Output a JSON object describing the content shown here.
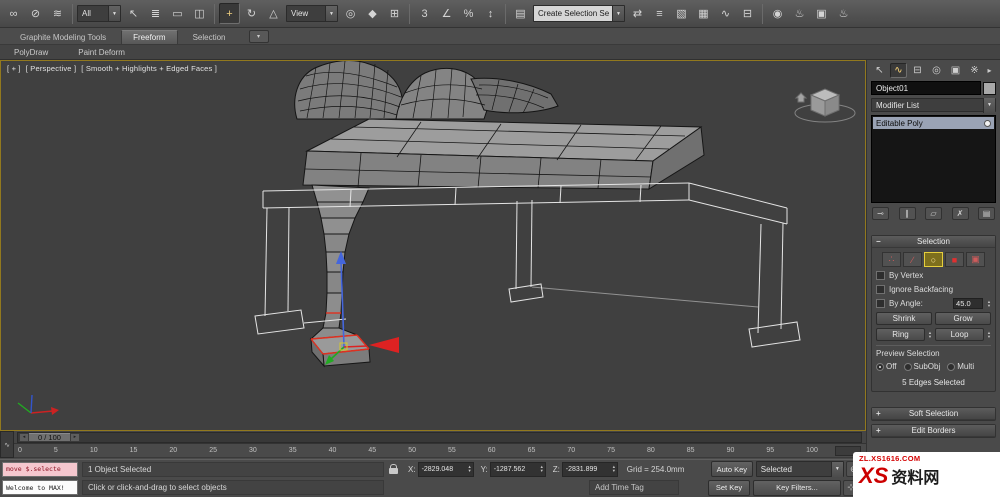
{
  "glyphs": {
    "combo_arrow": "▼",
    "spin_up": "▲",
    "spin_down": "▼",
    "slider_left": "◂",
    "slider_right": "▸",
    "rollout_open": "−",
    "rollout_closed": "+",
    "ribbon_toggle": "▾",
    "wave": "∿",
    "panel_menu": "▸",
    "zoom": "⊕",
    "zoom_all": "⊚",
    "pan": "⊹",
    "maximize": "⊞"
  },
  "toolbar": {
    "combos": {
      "filter": "All",
      "reference": "View",
      "selection_set": "Create Selection Se"
    },
    "icons_link": [
      {
        "n": "select-and-link-icon",
        "g": "∞"
      },
      {
        "n": "unlink-selection-icon",
        "g": "⊘"
      },
      {
        "n": "bind-to-spacewarp-icon",
        "g": "≋"
      }
    ],
    "icons_select": [
      {
        "n": "select-object-icon",
        "g": "↖"
      },
      {
        "n": "select-by-name-icon",
        "g": "≣"
      },
      {
        "n": "rectangular-selection-region-icon",
        "g": "▭"
      },
      {
        "n": "window-crossing-toggle-icon",
        "g": "◫"
      }
    ],
    "icons_transform": [
      {
        "n": "select-and-move-icon",
        "g": "+"
      },
      {
        "n": "select-and-rotate-icon",
        "g": "↻"
      },
      {
        "n": "select-and-scale-icon",
        "g": "△"
      }
    ],
    "icons_center": [
      {
        "n": "use-center-icon",
        "g": "◎"
      },
      {
        "n": "select-and-manipulate-icon",
        "g": "◆"
      },
      {
        "n": "keyboard-override-icon",
        "g": "⊞"
      }
    ],
    "icons_snap": [
      {
        "n": "snaps-toggle-icon",
        "g": "3"
      },
      {
        "n": "angle-snap-icon",
        "g": "∠"
      },
      {
        "n": "percent-snap-icon",
        "g": "%"
      },
      {
        "n": "spinner-snap-icon",
        "g": "↕"
      }
    ],
    "icons_named": [
      {
        "n": "edit-named-selection-sets-icon",
        "g": "▤"
      }
    ],
    "icons_tools": [
      {
        "n": "mirror-icon",
        "g": "⇄"
      },
      {
        "n": "align-icon",
        "g": "≡"
      },
      {
        "n": "layer-manager-icon",
        "g": "▧"
      },
      {
        "n": "graphite-ribbon-toggle-icon",
        "g": "▦"
      },
      {
        "n": "curve-editor-icon",
        "g": "∿"
      },
      {
        "n": "schematic-view-icon",
        "g": "⊟"
      }
    ],
    "icons_render": [
      {
        "n": "material-editor-icon",
        "g": "◉"
      },
      {
        "n": "render-setup-icon",
        "g": "♨"
      },
      {
        "n": "rendered-frame-window-icon",
        "g": "▣"
      },
      {
        "n": "render-production-icon",
        "g": "♨"
      }
    ]
  },
  "ribbon": {
    "tabs": [
      {
        "label": "Graphite Modeling Tools"
      },
      {
        "label": "Freeform"
      },
      {
        "label": "Selection"
      }
    ],
    "panels": [
      {
        "label": "PolyDraw"
      },
      {
        "label": "Paint Deform"
      }
    ]
  },
  "viewport": {
    "label_plus": "[ + ]",
    "label_view": "[ Perspective ]",
    "label_shading": "[ Smooth + Highlights + Edged Faces ]"
  },
  "command_panel": {
    "tabs": [
      {
        "n": "create-tab-icon",
        "g": "↖"
      },
      {
        "n": "modify-tab-icon",
        "g": "∿"
      },
      {
        "n": "hierarchy-tab-icon",
        "g": "⊟"
      },
      {
        "n": "motion-tab-icon",
        "g": "◎"
      },
      {
        "n": "display-tab-icon",
        "g": "▣"
      },
      {
        "n": "utilities-tab-icon",
        "g": "※"
      }
    ],
    "object_name": "Object01",
    "modifier_list": "Modifier List",
    "stack": [
      {
        "label": "Editable Poly"
      }
    ],
    "stack_buttons": [
      {
        "n": "pin-stack-icon",
        "g": "⊸"
      },
      {
        "n": "show-end-result-icon",
        "g": "∥"
      },
      {
        "n": "make-unique-icon",
        "g": "▱"
      },
      {
        "n": "remove-modifier-icon",
        "g": "✗"
      },
      {
        "n": "configure-modifier-sets-icon",
        "g": "▤"
      }
    ],
    "selection": {
      "title": "Selection",
      "subobject_icons": [
        {
          "n": "vertex-subobject-icon",
          "g": "∴"
        },
        {
          "n": "edge-subobject-icon",
          "g": "∕"
        },
        {
          "n": "border-subobject-icon",
          "g": "○"
        },
        {
          "n": "polygon-subobject-icon",
          "g": "■"
        },
        {
          "n": "element-subobject-icon",
          "g": "▣"
        }
      ],
      "by_vertex": "By Vertex",
      "ignore_backfacing": "Ignore Backfacing",
      "by_angle": "By Angle:",
      "angle_value": "45.0",
      "shrink": "Shrink",
      "grow": "Grow",
      "ring": "Ring",
      "loop": "Loop",
      "preview_label": "Preview Selection",
      "preview_options": [
        {
          "label": "Off",
          "name": "preview-off-radio"
        },
        {
          "label": "SubObj",
          "name": "preview-subobj-radio"
        },
        {
          "label": "Multi",
          "name": "preview-multi-radio"
        }
      ],
      "status": "5 Edges Selected"
    },
    "rollouts": [
      {
        "label": "Soft Selection"
      },
      {
        "label": "Edit Borders"
      }
    ]
  },
  "timeline": {
    "slider": "0 / 100",
    "ticks": [
      {
        "t": "0"
      },
      {
        "t": "5"
      },
      {
        "t": "10"
      },
      {
        "t": "15"
      },
      {
        "t": "20"
      },
      {
        "t": "25"
      },
      {
        "t": "30"
      },
      {
        "t": "35"
      },
      {
        "t": "40"
      },
      {
        "t": "45"
      },
      {
        "t": "50"
      },
      {
        "t": "55"
      },
      {
        "t": "60"
      },
      {
        "t": "65"
      },
      {
        "t": "70"
      },
      {
        "t": "75"
      },
      {
        "t": "80"
      },
      {
        "t": "85"
      },
      {
        "t": "90"
      },
      {
        "t": "95"
      },
      {
        "t": "100"
      }
    ]
  },
  "status_bar": {
    "macro_recorder": "move $.selecte",
    "listener": "Welcome to MAX!",
    "selection_status": "1 Object Selected",
    "prompt": "Click or click-and-drag to select objects",
    "coord_x_label": "X:",
    "coord_x": "-2829.048",
    "coord_y_label": "Y:",
    "coord_y": "-1287.562",
    "coord_z_label": "Z:",
    "coord_z": "-2831.899",
    "grid": "Grid = 254.0mm",
    "time_tag": "Add Time Tag",
    "auto_key": "Auto Key",
    "set_key": "Set Key",
    "key_mode": "Selected",
    "key_filters": "Key Filters..."
  },
  "watermark": {
    "site": "ZL.XS1616.COM",
    "logo": "XS",
    "name": "资料网"
  }
}
